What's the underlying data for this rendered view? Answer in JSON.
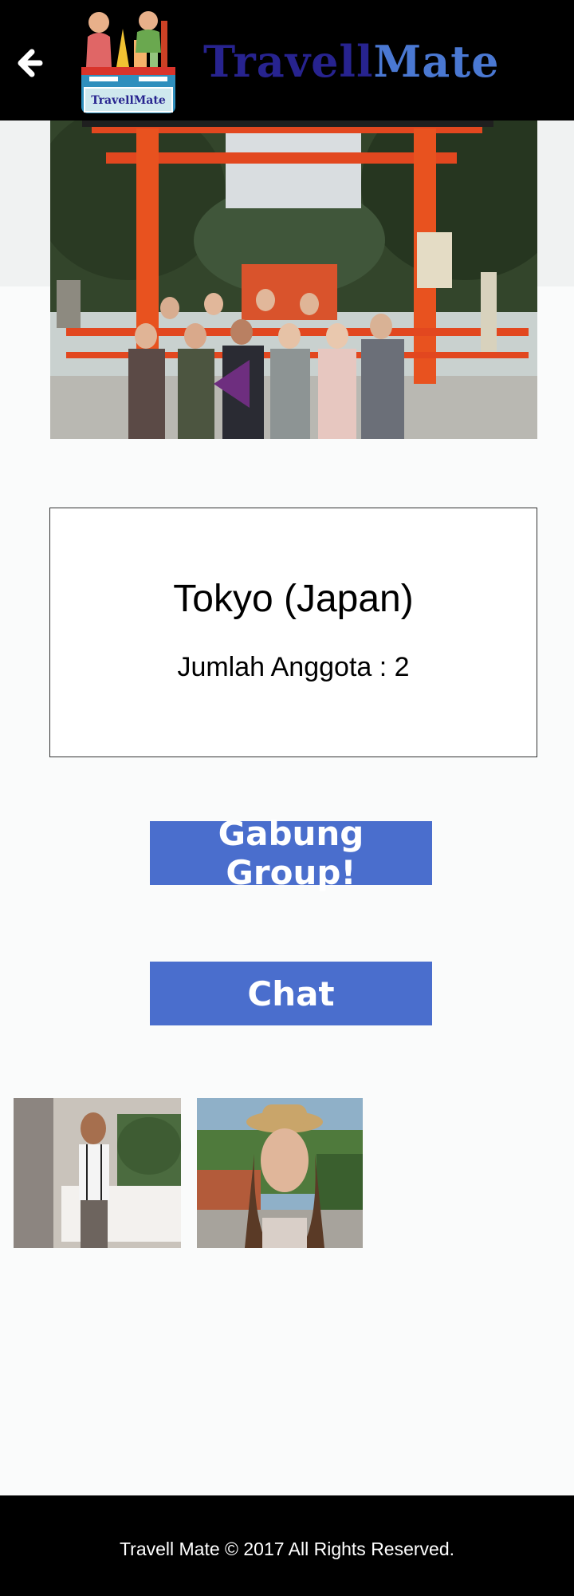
{
  "header": {
    "brand_part1": "Travell",
    "brand_part2": "Mate",
    "logo_badge": "TravellMate",
    "back_icon": "arrow-left-icon"
  },
  "group": {
    "title": "Tokyo (Japan)",
    "member_count": "Jumlah Anggota : 2"
  },
  "actions": {
    "join_label": "Gabung Group!",
    "chat_label": "Chat"
  },
  "members": [
    {
      "photo": "member-photo-man"
    },
    {
      "photo": "member-photo-woman"
    }
  ],
  "footer": {
    "text": "Travell Mate © 2017 All Rights Reserved."
  },
  "colors": {
    "header_bg": "#000000",
    "brand_dark": "#27238f",
    "brand_light": "#4a78d2",
    "button_bg": "#4a6ecd",
    "torii_red": "#e2471f"
  }
}
